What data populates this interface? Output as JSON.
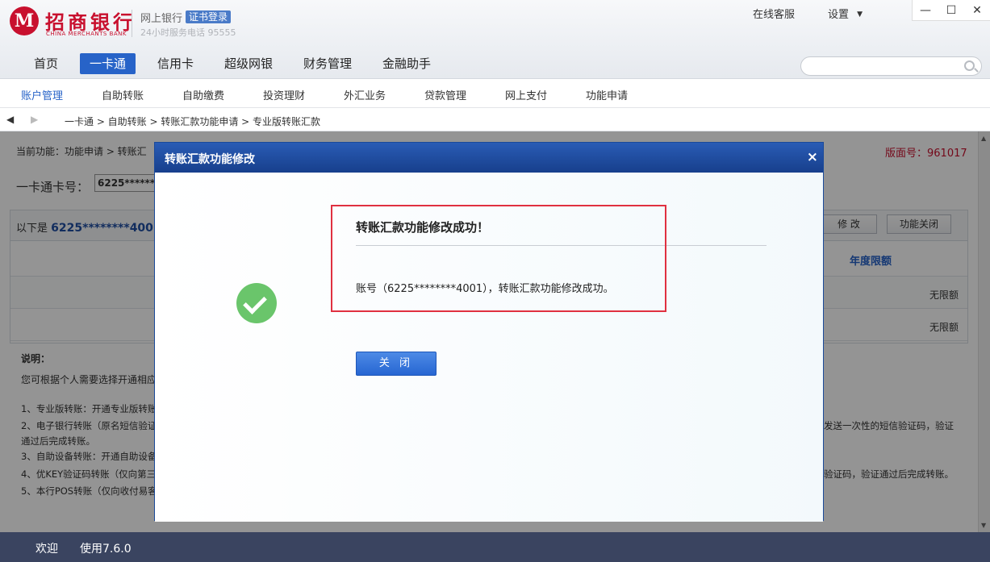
{
  "header": {
    "logo_glyph": "M",
    "bank_name": "招商银行",
    "bank_name_en": "CHINA MERCHANTS BANK",
    "product": "网上银行",
    "cert_badge": "证书登录",
    "hotline": "24小时服务电话 95555",
    "online_service": "在线客服",
    "settings": "设置",
    "settings_caret": "▼",
    "minimize": "—",
    "maximize": "☐",
    "close": "✕"
  },
  "main_nav": {
    "items": [
      "首页",
      "一卡通",
      "信用卡",
      "超级网银",
      "财务管理",
      "金融助手"
    ],
    "active_index": 1,
    "search_placeholder": ""
  },
  "sub_nav": {
    "items": [
      "账户管理",
      "自助转账",
      "自助缴费",
      "投资理财",
      "外汇业务",
      "贷款管理",
      "网上支付",
      "功能申请"
    ],
    "active_index": 0
  },
  "breadcrumb": {
    "back": "◀",
    "forward": "▶",
    "path": "一卡通 > 自助转账 > 转账汇款功能申请 > 专业版转账汇款"
  },
  "content": {
    "current_function": "当前功能：功能申请 > 转账汇",
    "version": "版面号：961017",
    "card_label": "一卡通卡号：",
    "card_value": "6225*******",
    "list_prefix": "以下是",
    "list_card": "6225********4001",
    "modify_btn": "修 改",
    "close_func_btn": "功能关闭",
    "annual_limit": "年度限额",
    "row1_value": "无限额",
    "row2_value": "无限额",
    "note_title": "说明：",
    "note_intro": "您可根据个人需要选择开通相应",
    "notes": [
      "1、专业版转账：开通专业版转账",
      "2、电子银行转账（原名短信验证",
      "通过后完成转账。",
      "3、自助设备转账：开通自助设备",
      "4、优KEY验证码转账（仅向第三",
      "5、本行POS转账（仅向收付易客"
    ],
    "note2_tail": "发送一次性的短信验证码，验证",
    "note4_tail": "验证码，验证通过后完成转账。"
  },
  "dialog": {
    "title": "转账汇款功能修改",
    "close_icon": "×",
    "success_title": "转账汇款功能修改成功！",
    "success_message": "账号（6225********4001），转账汇款功能修改成功。",
    "close_button": "关 闭"
  },
  "status_bar": {
    "welcome": "欢迎",
    "version": "使用7.6.0"
  },
  "colors": {
    "brand_red": "#c8102e",
    "nav_active": "#2763c8",
    "dialog_header": "#1f4ea3",
    "success_green": "#6ac56b",
    "highlight_red": "#e03040"
  }
}
